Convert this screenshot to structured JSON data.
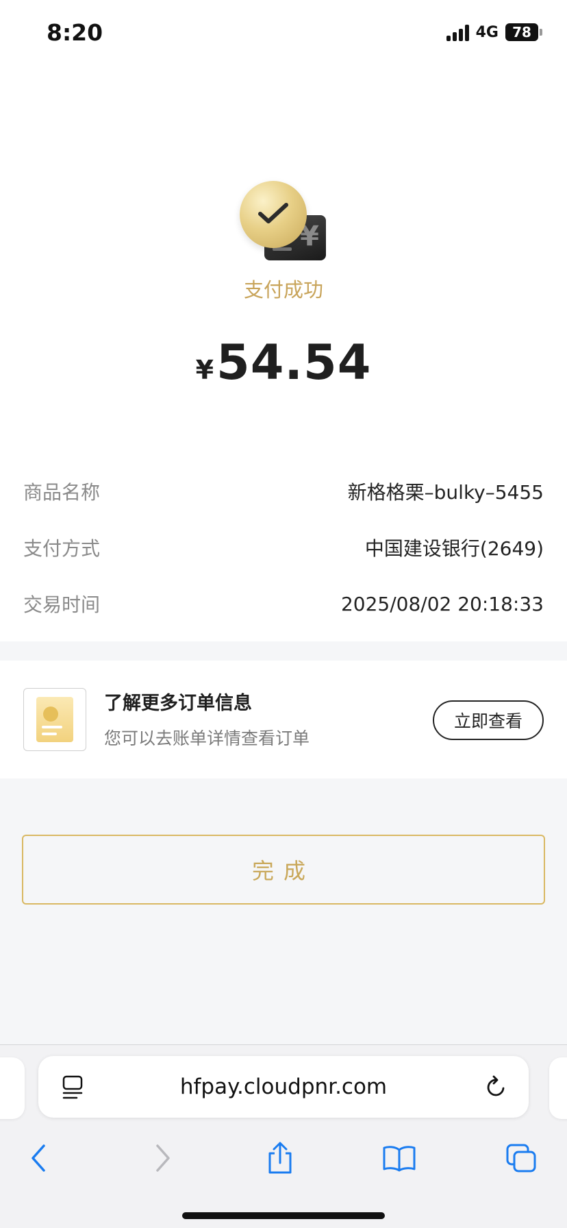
{
  "status_bar": {
    "time": "8:20",
    "network": "4G",
    "battery": "78"
  },
  "payment": {
    "status_text": "支付成功",
    "currency_symbol": "¥",
    "amount": "54.54"
  },
  "details": [
    {
      "label": "商品名称",
      "value": "新格格栗–bulky–5455"
    },
    {
      "label": "支付方式",
      "value": "中国建设银行(2649)"
    },
    {
      "label": "交易时间",
      "value": "2025/08/02 20:18:33"
    }
  ],
  "order_info": {
    "title": "了解更多订单信息",
    "subtitle": "您可以去账单详情查看订单",
    "button_label": "立即查看"
  },
  "done_button": {
    "label": "完成"
  },
  "browser": {
    "url": "hfpay.cloudpnr.com",
    "toolbar_icons": [
      "back-icon",
      "forward-icon",
      "share-icon",
      "bookmarks-icon",
      "tabs-icon"
    ]
  },
  "colors": {
    "accent_gold": "#c8a45a",
    "text_primary": "#1f1f1f",
    "text_secondary": "#8a8a8a",
    "link_blue": "#1a7cf0"
  }
}
